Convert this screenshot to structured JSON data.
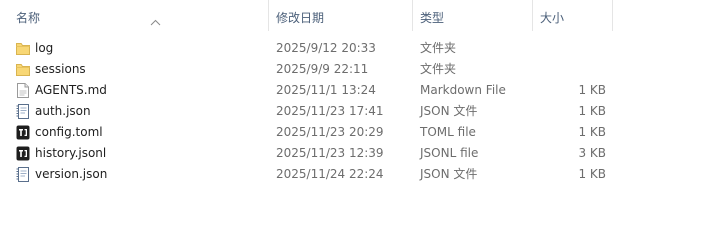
{
  "columns": {
    "name": "名称",
    "date": "修改日期",
    "type": "类型",
    "size": "大小"
  },
  "files": [
    {
      "name": "log",
      "date": "2025/9/12 20:33",
      "type": "文件夹",
      "size": "",
      "icon": "folder-icon"
    },
    {
      "name": "sessions",
      "date": "2025/9/9 22:11",
      "type": "文件夹",
      "size": "",
      "icon": "folder-icon"
    },
    {
      "name": "AGENTS.md",
      "date": "2025/11/1 13:24",
      "type": "Markdown File",
      "size": "1 KB",
      "icon": "markdown-file-icon"
    },
    {
      "name": "auth.json",
      "date": "2025/11/23 17:41",
      "type": "JSON 文件",
      "size": "1 KB",
      "icon": "json-file-icon"
    },
    {
      "name": "config.toml",
      "date": "2025/11/23 20:29",
      "type": "TOML file",
      "size": "1 KB",
      "icon": "toml-file-icon"
    },
    {
      "name": "history.jsonl",
      "date": "2025/11/23 12:39",
      "type": "JSONL file",
      "size": "3 KB",
      "icon": "jsonl-file-icon"
    },
    {
      "name": "version.json",
      "date": "2025/11/24 22:24",
      "type": "JSON 文件",
      "size": "1 KB",
      "icon": "json-file-icon"
    }
  ],
  "colors": {
    "header_text": "#4c607a",
    "folder_yellow": "#f8d775",
    "secondary_text": "#6d6d6d"
  }
}
